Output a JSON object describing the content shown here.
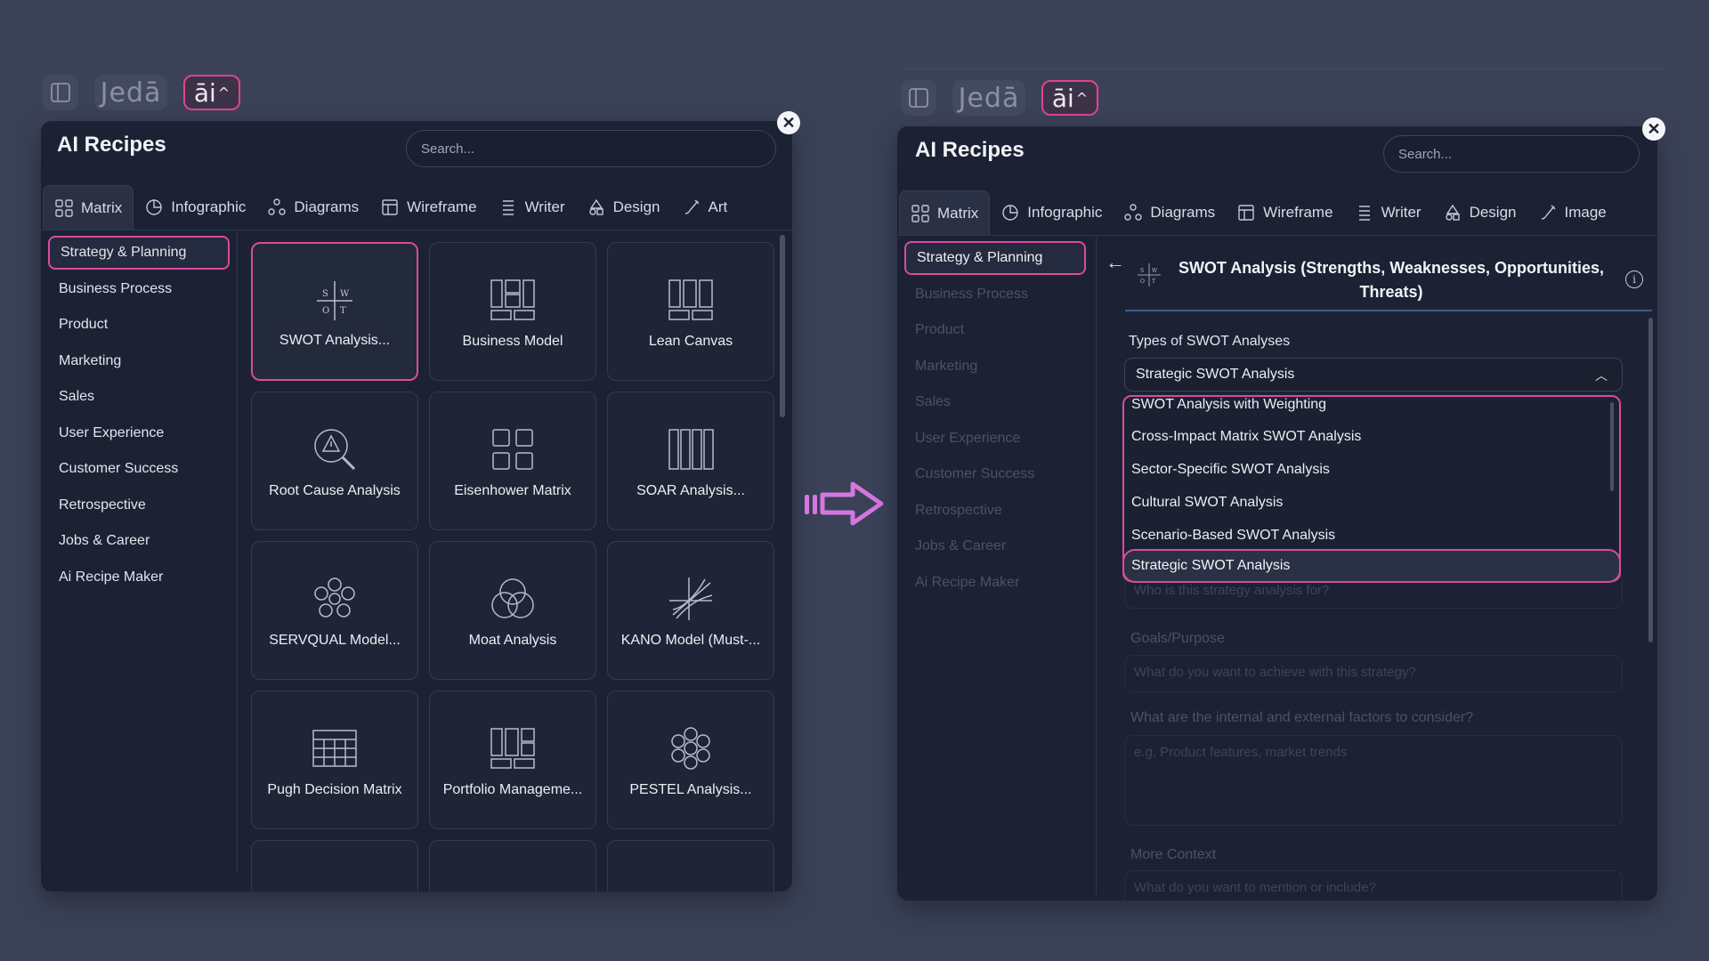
{
  "brand": {
    "logo_text": "Jedā",
    "ai_label": "āi",
    "ai_chevron": "^"
  },
  "panel": {
    "title": "AI Recipes",
    "search_placeholder": "Search..."
  },
  "left": {
    "tabs": [
      {
        "label": "Matrix",
        "icon": "grid-icon",
        "active": true
      },
      {
        "label": "Infographic",
        "icon": "pie-chart-icon"
      },
      {
        "label": "Diagrams",
        "icon": "nodes-icon"
      },
      {
        "label": "Wireframe",
        "icon": "wireframe-icon"
      },
      {
        "label": "Writer",
        "icon": "text-lines-icon"
      },
      {
        "label": "Design",
        "icon": "shapes-icon"
      },
      {
        "label": "Art",
        "icon": "brush-icon"
      }
    ],
    "categories": [
      {
        "label": "Strategy & Planning",
        "active": true
      },
      {
        "label": "Business Process"
      },
      {
        "label": "Product"
      },
      {
        "label": "Marketing"
      },
      {
        "label": "Sales"
      },
      {
        "label": "User Experience"
      },
      {
        "label": "Customer Success"
      },
      {
        "label": "Retrospective"
      },
      {
        "label": "Jobs & Career"
      },
      {
        "label": "Ai Recipe Maker"
      }
    ],
    "cards": [
      {
        "label": "SWOT Analysis...",
        "icon": "swot-icon",
        "active": true
      },
      {
        "label": "Business Model",
        "icon": "business-model-icon"
      },
      {
        "label": "Lean Canvas",
        "icon": "lean-canvas-icon"
      },
      {
        "label": "Root Cause Analysis",
        "icon": "magnifier-warning-icon"
      },
      {
        "label": "Eisenhower Matrix",
        "icon": "four-quadrant-icon"
      },
      {
        "label": "SOAR Analysis...",
        "icon": "columns-icon"
      },
      {
        "label": "SERVQUAL Model...",
        "icon": "flower-icon"
      },
      {
        "label": "Moat Analysis",
        "icon": "overlap-circles-icon"
      },
      {
        "label": "KANO Model (Must-...",
        "icon": "kano-lines-icon"
      },
      {
        "label": "Pugh Decision Matrix",
        "icon": "table-grid-icon"
      },
      {
        "label": "Portfolio Manageme...",
        "icon": "portfolio-icon"
      },
      {
        "label": "PESTEL Analysis...",
        "icon": "hexagon-cluster-icon"
      }
    ]
  },
  "right": {
    "tabs": [
      {
        "label": "Matrix",
        "icon": "grid-icon",
        "active": true
      },
      {
        "label": "Infographic",
        "icon": "pie-chart-icon"
      },
      {
        "label": "Diagrams",
        "icon": "nodes-icon"
      },
      {
        "label": "Wireframe",
        "icon": "wireframe-icon"
      },
      {
        "label": "Writer",
        "icon": "text-lines-icon"
      },
      {
        "label": "Design",
        "icon": "shapes-icon"
      },
      {
        "label": "Image",
        "icon": "brush-icon"
      }
    ],
    "detail": {
      "back_arrow": "←",
      "title_line1": "SWOT Analysis (Strengths, Weaknesses, Opportunities,",
      "title_line2": "Threats)",
      "info": "i",
      "types_label": "Types of SWOT Analyses",
      "selected_value": "Strategic SWOT Analysis",
      "options": [
        "SWOT Analysis with Weighting",
        "Cross-Impact Matrix SWOT Analysis",
        "Sector-Specific SWOT Analysis",
        "Cultural SWOT Analysis",
        "Scenario-Based SWOT Analysis",
        "Strategic SWOT Analysis"
      ],
      "audience_placeholder": "Who is this strategy analysis for?",
      "goals_label": "Goals/Purpose",
      "goals_placeholder": "What do you want to achieve with this strategy?",
      "factors_label": "What are the internal and external factors to consider?",
      "factors_placeholder": "e.g. Product features, market trends",
      "context_label": "More Context",
      "context_placeholder": "What do you want to mention or include?"
    }
  },
  "colors": {
    "accent": "#d94b9c",
    "panel_bg": "#1c2234",
    "page_bg": "#3b4258",
    "arrow": "#d676e0"
  }
}
